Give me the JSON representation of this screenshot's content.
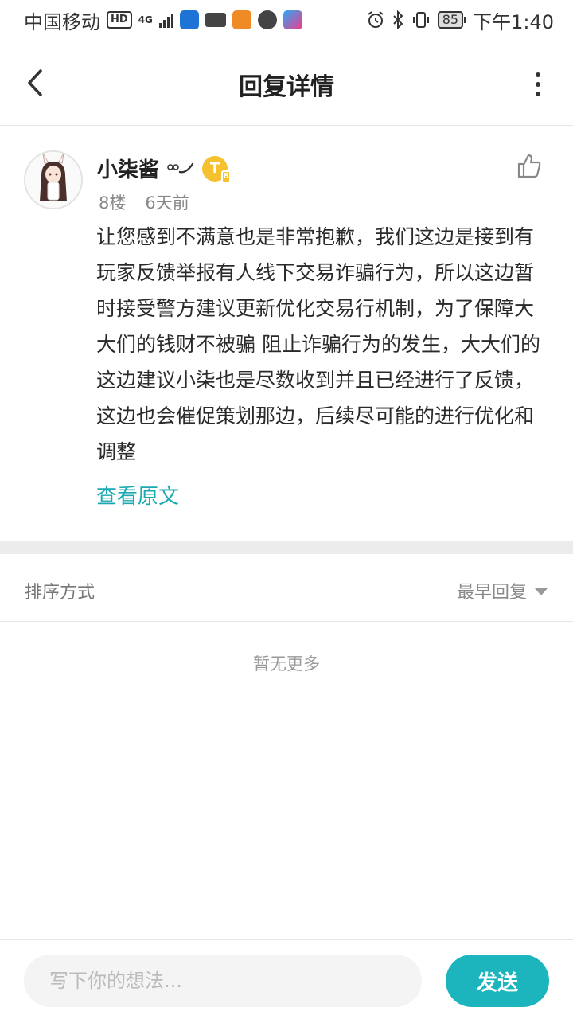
{
  "status_bar": {
    "carrier": "中国移动",
    "hd": "HD",
    "network": "4G",
    "battery": "85",
    "time": "下午1:40",
    "icons": [
      "hd-icon",
      "signal-icon",
      "shield-app-icon",
      "briefcase-app-icon",
      "uc-browser-icon",
      "message-icon",
      "youku-icon",
      "alarm-icon",
      "bluetooth-icon",
      "vibrate-icon",
      "battery-icon"
    ]
  },
  "header": {
    "title": "回复详情",
    "back_icon": "chevron-left-icon",
    "more_icon": "more-vertical-icon"
  },
  "comment": {
    "username": "小柒酱",
    "badge_letter": "T",
    "badge_level": "8",
    "floor": "8楼",
    "time_ago": "6天前",
    "content": "让您感到不满意也是非常抱歉，我们这边是接到有玩家反馈举报有人线下交易诈骗行为，所以这边暂时接受警方建议更新优化交易行机制，为了保障大大们的钱财不被骗 阻止诈骗行为的发生，大大们的这边建议小柒也是尽数收到并且已经进行了反馈，这边也会催促策划那边，后续尽可能的进行优化和调整",
    "view_original": "查看原文",
    "like_icon": "thumbs-up-icon"
  },
  "sort": {
    "label": "排序方式",
    "selected": "最早回复"
  },
  "replies": {
    "empty_text": "暂无更多"
  },
  "input_bar": {
    "placeholder": "写下你的想法...",
    "send_label": "发送"
  },
  "colors": {
    "accent": "#1db5bd",
    "link": "#1aa9b0",
    "badge": "#f5c12e"
  }
}
